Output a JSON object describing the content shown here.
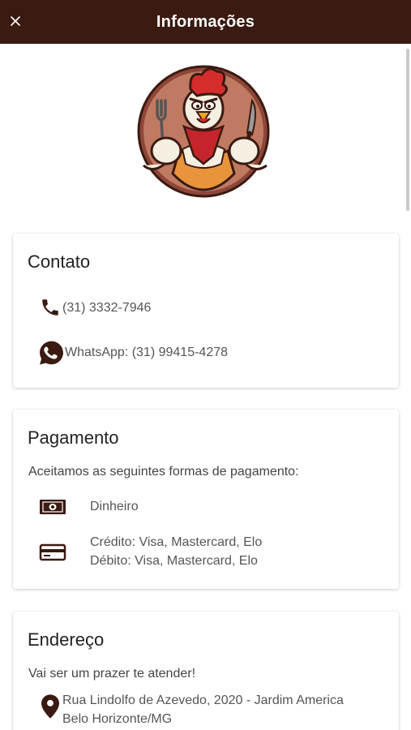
{
  "header": {
    "title": "Informações",
    "close_icon": "close-icon",
    "background": "#3a1a11"
  },
  "contact": {
    "title": "Contato",
    "phone": "(31) 3332-7946",
    "whatsapp": "WhatsApp: (31) 99415-4278",
    "phone_icon": "phone-icon",
    "whatsapp_icon": "whatsapp-icon"
  },
  "payment": {
    "title": "Pagamento",
    "lead": "Aceitamos as seguintes formas de pagamento:",
    "cash": "Dinheiro",
    "credit": "Crédito: Visa, Mastercard, Elo",
    "debit": "Débito: Visa, Mastercard, Elo",
    "cash_icon": "cash-icon",
    "card_icon": "credit-card-icon"
  },
  "address": {
    "title": "Endereço",
    "lead": "Vai ser um prazer te atender!",
    "line1": "Rua Lindolfo de Azevedo, 2020 - Jardim America",
    "line2": "Belo Horizonte/MG",
    "pin_icon": "location-pin-icon"
  }
}
